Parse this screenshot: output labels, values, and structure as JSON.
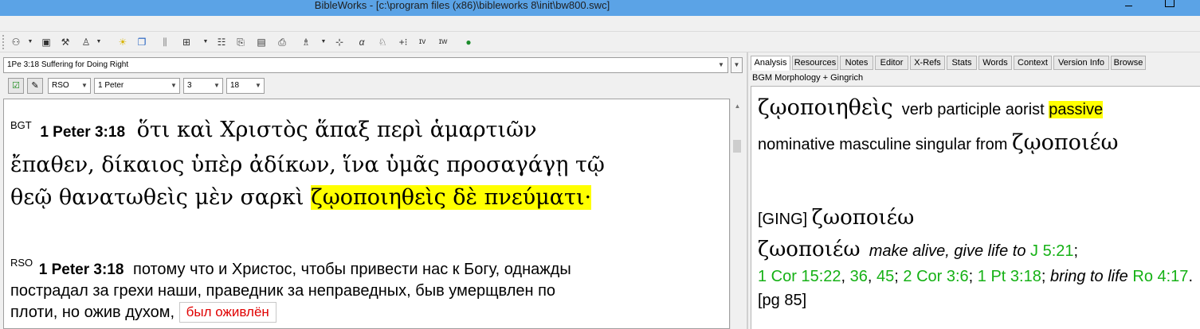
{
  "window": {
    "title": "BibleWorks - [c:\\program files (x86)\\bibleworks 8\\init\\bw800.swc]"
  },
  "toolbar": {
    "icons": [
      "users-icon",
      "briefcase-icon",
      "tools-icon",
      "person-icon",
      "sun-icon",
      "window-icon",
      "columns-icon",
      "grid-icon",
      "list-icon",
      "copy-icon",
      "folder-icon",
      "printer-icon",
      "person-down-icon",
      "arrows-icon",
      "alpha-icon",
      "person-search-icon",
      "plus-icon",
      "ev-icon",
      "ew-icon",
      "globe-icon"
    ]
  },
  "left": {
    "passage_header": "1Pe 3:18 Suffering for Doing Right",
    "version": "RSO",
    "book": "1 Peter",
    "chapter": "3",
    "verse": "18",
    "bgt": {
      "tag": "BGT",
      "ref": "1 Peter 3:18",
      "line1": "ὅτι καὶ Χριστὸς ἅπαξ περὶ ἁμαρτιῶν",
      "line2": "ἔπαθεν, δίκαιος ὑπὲρ ἀδίκων, ἵνα ὑμᾶς προσαγάγῃ τῷ",
      "line3_plain": "θεῷ θανατωθεὶς μὲν σαρκὶ ",
      "line3_highlight": "ζῳοποιηθεὶς δὲ πνεύματι·"
    },
    "rso": {
      "tag": "RSO",
      "ref": "1 Peter 3:18",
      "line1": "потому что и Христос, чтобы привести нас к Богу, однажды",
      "line2": "пострадал за грехи наши, праведник за неправедных, быв умерщвлен по",
      "line3": "плоти, но ожив духом,",
      "correction": "был оживлён"
    }
  },
  "right": {
    "tabs": [
      "Analysis",
      "Resources",
      "Notes",
      "Editor",
      "X-Refs",
      "Stats",
      "Words",
      "Context",
      "Version Info",
      "Browse"
    ],
    "source": "BGM Morphology + Gingrich",
    "word": "ζῳοποιηθεὶς",
    "parse1": "verb participle aorist",
    "parse_hl": "passive",
    "parse2": "nominative masculine singular from",
    "lemma": "ζῳοποιέω",
    "ging_tag": "[GING]",
    "ging_lemma": "ζωοποιέω",
    "entry_lemma": "ζωοποιέω",
    "def1": "make alive, give life to",
    "ref1": "J 5:21",
    "ref2": "1 Cor 15:22",
    "ref3": "36",
    "ref4": "45",
    "ref5": "2 Cor 3:6",
    "ref6": "1 Pt 3:18",
    "def2": "bring to life",
    "ref7": "Ro 4:17",
    "page": "[pg 85]"
  }
}
